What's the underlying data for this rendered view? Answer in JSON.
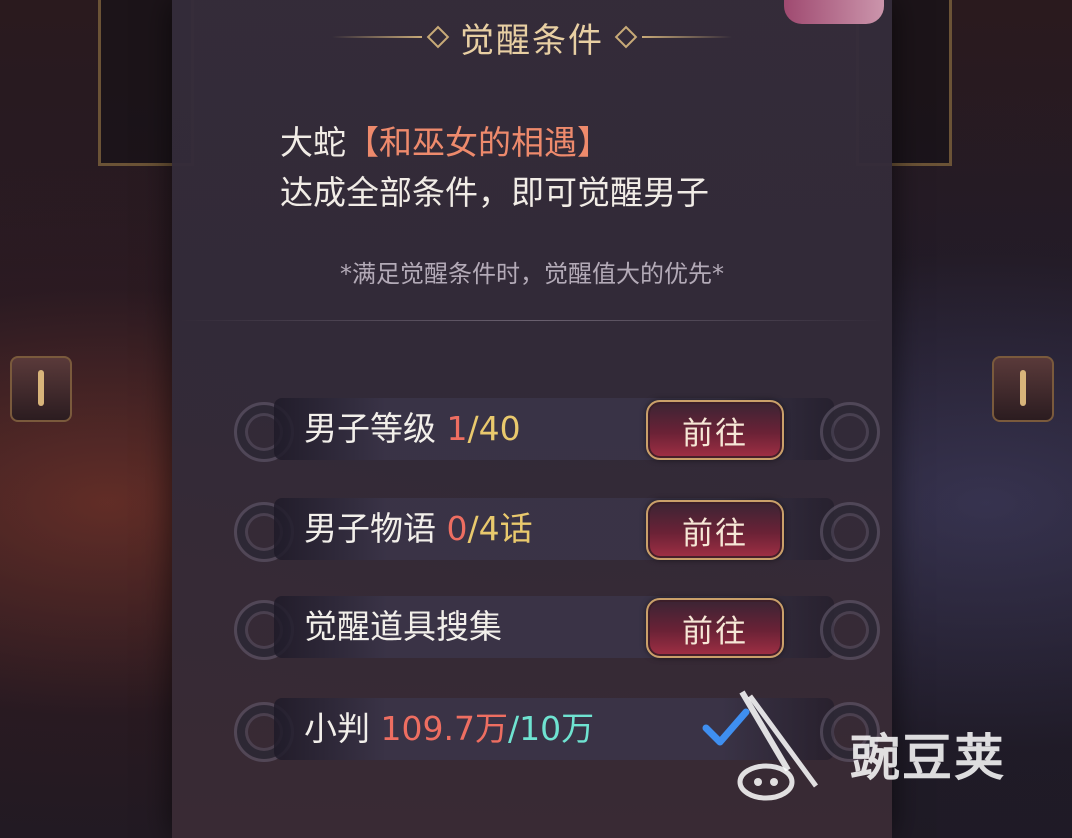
{
  "panel": {
    "title": "觉醒条件",
    "desc": {
      "line1_prefix": "大蛇",
      "line1_highlight": "【和巫女的相遇】",
      "line2": "达成全部条件，即可觉醒男子"
    },
    "note": "*满足觉醒条件时，觉醒值大的优先*"
  },
  "conditions": [
    {
      "label": "男子等级 ",
      "current": "1",
      "separator": "/",
      "target": "40",
      "suffix": "",
      "action": "前往"
    },
    {
      "label": "男子物语 ",
      "current": "0",
      "separator": "/",
      "target": "4",
      "suffix": "话",
      "action": "前往"
    },
    {
      "label": "觉醒道具搜集",
      "action": "前往"
    },
    {
      "label": "小判 ",
      "current": "109.7万",
      "separator": "/",
      "target": "10万",
      "status": "completed",
      "icon": "checkmark-icon"
    }
  ],
  "watermark": {
    "text": "豌豆荚",
    "icon": "wandoujia-logo-icon"
  },
  "colors": {
    "title": "#e8cfa3",
    "highlight": "#ee8a6c",
    "current_incomplete": "#ee6e61",
    "target": "#e9c96d",
    "completed": "#6fe3d1"
  }
}
